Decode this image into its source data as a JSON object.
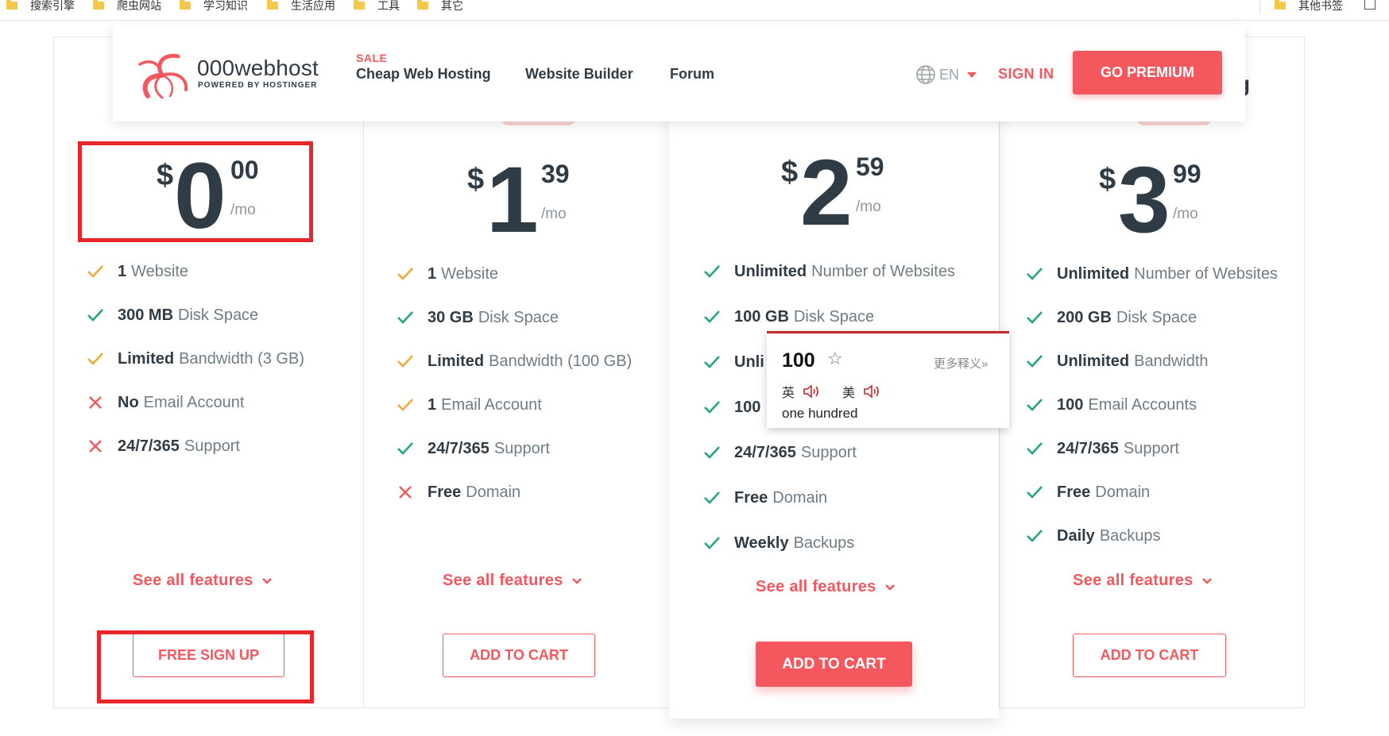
{
  "bookmarks": [
    "搜索引擎",
    "爬虫网站",
    "学习知识",
    "生活应用",
    "工具",
    "其它"
  ],
  "other_bookmarks": "其他书签",
  "header": {
    "logo_text": "000webhost",
    "logo_sub": "POWERED BY HOSTINGER",
    "sale_badge": "SALE",
    "nav": [
      "Cheap Web Hosting",
      "Website Builder",
      "Forum"
    ],
    "language": "EN",
    "sign_in": "SIGN IN",
    "go_premium": "GO PREMIUM"
  },
  "peek_letter": "g",
  "colors": {
    "accent": "#f4575d",
    "text": "#2f3b45",
    "muted": "#6f7c85",
    "check": "#27a776",
    "warn": "#f0a93b",
    "cross": "#f4575d"
  },
  "plans": [
    {
      "currency": "$",
      "dollars": "0",
      "cents": "00",
      "period": "/mo",
      "features": [
        {
          "icon": "warn",
          "bold": "1",
          "text": "Website"
        },
        {
          "icon": "check",
          "bold": "300 MB",
          "text": "Disk Space"
        },
        {
          "icon": "warn",
          "bold": "Limited",
          "text": "Bandwidth (3 GB)"
        },
        {
          "icon": "cross",
          "bold": "No",
          "text": "Email Account"
        },
        {
          "icon": "cross",
          "bold": "24/7/365",
          "text": "Support"
        }
      ],
      "see_all": "See all features",
      "cta": "FREE SIGN UP"
    },
    {
      "currency": "$",
      "dollars": "1",
      "cents": "39",
      "period": "/mo",
      "features": [
        {
          "icon": "warn",
          "bold": "1",
          "text": "Website"
        },
        {
          "icon": "check",
          "bold": "30 GB",
          "text": "Disk Space"
        },
        {
          "icon": "warn",
          "bold": "Limited",
          "text": "Bandwidth (100 GB)"
        },
        {
          "icon": "warn",
          "bold": "1",
          "text": "Email Account"
        },
        {
          "icon": "check",
          "bold": "24/7/365",
          "text": "Support"
        },
        {
          "icon": "cross",
          "bold": "Free",
          "text": "Domain"
        }
      ],
      "see_all": "See all features",
      "cta": "ADD TO CART"
    },
    {
      "currency": "$",
      "dollars": "2",
      "cents": "59",
      "period": "/mo",
      "features": [
        {
          "icon": "check",
          "bold": "Unlimited",
          "text": "Number of Websites"
        },
        {
          "icon": "check",
          "bold": "100 GB",
          "text": "Disk Space"
        },
        {
          "icon": "check",
          "bold": "Unli",
          "text": ""
        },
        {
          "icon": "check",
          "bold": "100",
          "text": ""
        },
        {
          "icon": "check",
          "bold": "24/7/365",
          "text": "Support"
        },
        {
          "icon": "check",
          "bold": "Free",
          "text": "Domain"
        },
        {
          "icon": "check",
          "bold": "Weekly",
          "text": "Backups"
        }
      ],
      "see_all": "See all features",
      "cta": "ADD TO CART"
    },
    {
      "currency": "$",
      "dollars": "3",
      "cents": "99",
      "period": "/mo",
      "features": [
        {
          "icon": "check",
          "bold": "Unlimited",
          "text": "Number of Websites"
        },
        {
          "icon": "check",
          "bold": "200 GB",
          "text": "Disk Space"
        },
        {
          "icon": "check",
          "bold": "Unlimited",
          "text": "Bandwidth"
        },
        {
          "icon": "check",
          "bold": "100",
          "text": "Email Accounts"
        },
        {
          "icon": "check",
          "bold": "24/7/365",
          "text": "Support"
        },
        {
          "icon": "check",
          "bold": "Free",
          "text": "Domain"
        },
        {
          "icon": "check",
          "bold": "Daily",
          "text": "Backups"
        }
      ],
      "see_all": "See all features",
      "cta": "ADD TO CART"
    }
  ],
  "dictionary": {
    "word": "100",
    "more": "更多释义»",
    "uk_label": "英",
    "us_label": "美",
    "definition": "one hundred"
  }
}
